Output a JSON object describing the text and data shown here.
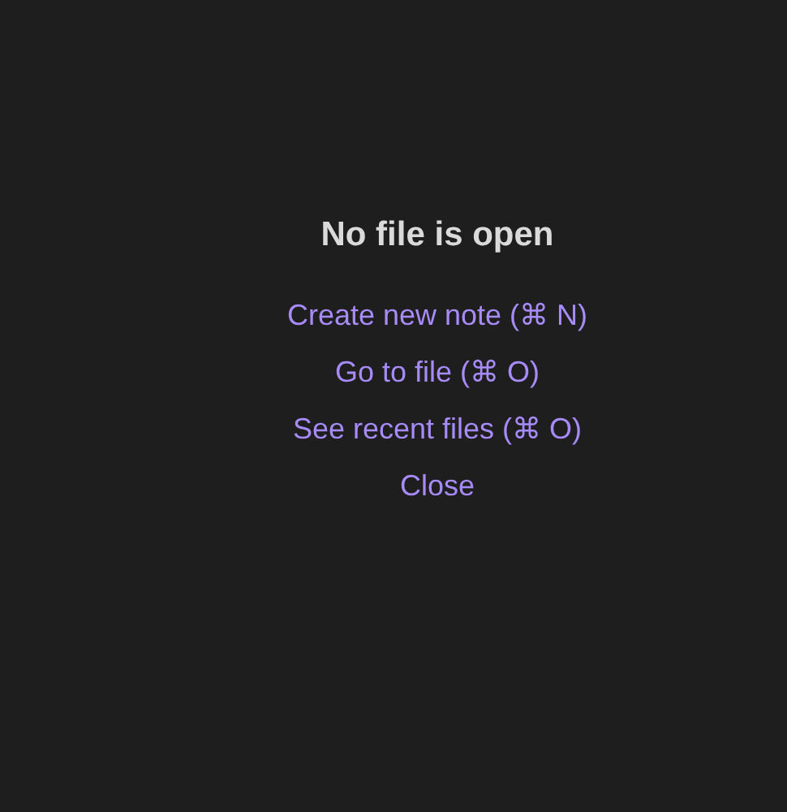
{
  "empty_state": {
    "title": "No file is open",
    "actions": [
      {
        "label": "Create new note (⌘ N)"
      },
      {
        "label": "Go to file (⌘ O)"
      },
      {
        "label": "See recent files (⌘ O)"
      },
      {
        "label": "Close"
      }
    ]
  }
}
